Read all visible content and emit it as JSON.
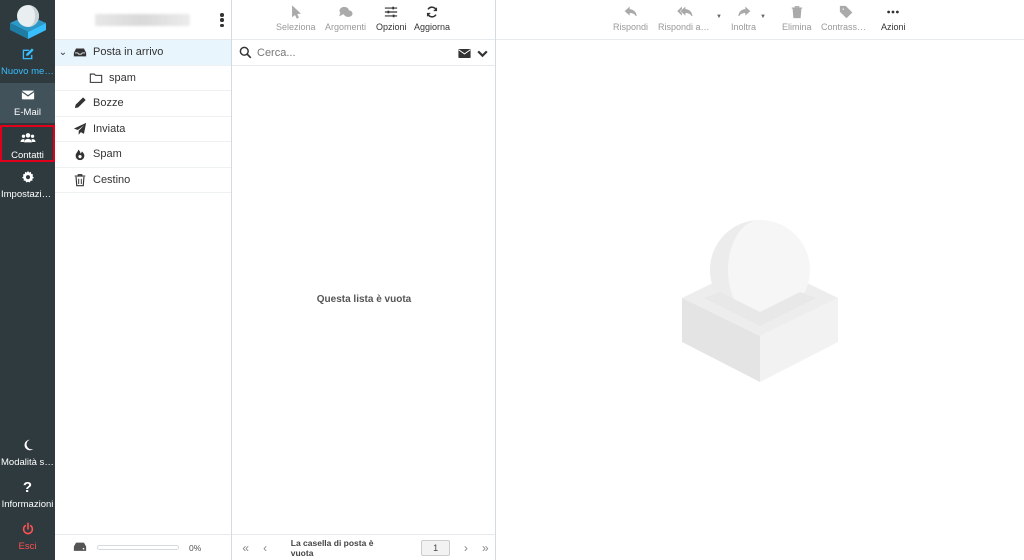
{
  "nav": {
    "compose": "Nuovo messaggio",
    "mail": "E-Mail",
    "contacts": "Contatti",
    "settings": "Impostazioni",
    "darkmode": "Modalità scura",
    "about": "Informazioni",
    "logout": "Esci"
  },
  "folders": [
    {
      "name": "Posta in arrivo",
      "icon": "inbox-icon",
      "selected": true
    },
    {
      "name": "spam",
      "icon": "folder-icon"
    },
    {
      "name": "Bozze",
      "icon": "pencil-icon"
    },
    {
      "name": "Inviata",
      "icon": "paper-plane-icon"
    },
    {
      "name": "Spam",
      "icon": "fire-icon"
    },
    {
      "name": "Cestino",
      "icon": "trash-icon"
    }
  ],
  "quota": {
    "percent_label": "0%",
    "value": 0
  },
  "list_toolbar": {
    "select": "Seleziona",
    "threads": "Argomenti",
    "options": "Opzioni",
    "refresh": "Aggiorna"
  },
  "search": {
    "placeholder": "Cerca..."
  },
  "list": {
    "empty_message": "Questa lista è vuota",
    "footer_status": "La casella di posta è vuota",
    "page": "1"
  },
  "preview_toolbar": {
    "reply": "Rispondi",
    "reply_all": "Rispondi a tutti",
    "forward": "Inoltra",
    "delete": "Elimina",
    "mark": "Contrassegna",
    "actions": "Azioni"
  },
  "colors": {
    "nav_bg": "#2f3a3f",
    "nav_active": "#41525a",
    "accent": "#37beff",
    "logout": "#ff5252",
    "highlight_border": "#e0001b",
    "selected_folder": "#e8f5fc"
  }
}
